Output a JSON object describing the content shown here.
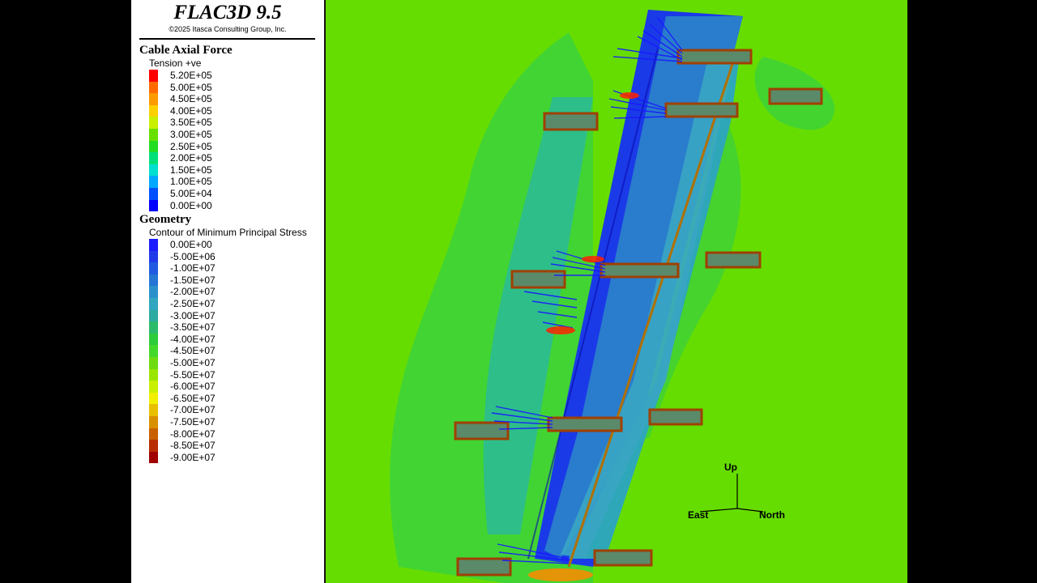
{
  "app": {
    "title": "FLAC3D 9.5",
    "copyright": "©2025 Itasca Consulting Group, Inc."
  },
  "legend_cable": {
    "title": "Cable Axial Force",
    "subtitle": "Tension +ve",
    "entries": [
      {
        "label": "5.20E+05",
        "color": "#ff0000"
      },
      {
        "label": "5.00E+05",
        "color": "#ff6a00"
      },
      {
        "label": "4.50E+05",
        "color": "#ff9a00"
      },
      {
        "label": "4.00E+05",
        "color": "#ffd000"
      },
      {
        "label": "3.50E+05",
        "color": "#c8f000"
      },
      {
        "label": "3.00E+05",
        "color": "#66e000"
      },
      {
        "label": "2.50E+05",
        "color": "#22dd22"
      },
      {
        "label": "2.00E+05",
        "color": "#00e07a"
      },
      {
        "label": "1.50E+05",
        "color": "#00e0d0"
      },
      {
        "label": "1.00E+05",
        "color": "#00a8ff"
      },
      {
        "label": "5.00E+04",
        "color": "#0050ff"
      },
      {
        "label": "0.00E+00",
        "color": "#0000ff"
      }
    ]
  },
  "legend_geometry": {
    "title": "Geometry",
    "subtitle": "Contour of Minimum Principal Stress",
    "entries": [
      {
        "label": "0.00E+00",
        "color": "#1a1aff"
      },
      {
        "label": "-5.00E+06",
        "color": "#1f3ae8"
      },
      {
        "label": "-1.00E+07",
        "color": "#1f5ae0"
      },
      {
        "label": "-1.50E+07",
        "color": "#2376d4"
      },
      {
        "label": "-2.00E+07",
        "color": "#2a90cc"
      },
      {
        "label": "-2.50E+07",
        "color": "#30a6c0"
      },
      {
        "label": "-3.00E+07",
        "color": "#2eaaa0"
      },
      {
        "label": "-3.50E+07",
        "color": "#2cbb6a"
      },
      {
        "label": "-4.00E+07",
        "color": "#2ccc3a"
      },
      {
        "label": "-4.50E+07",
        "color": "#44d82a"
      },
      {
        "label": "-5.00E+07",
        "color": "#6edc10"
      },
      {
        "label": "-5.50E+07",
        "color": "#9ae600"
      },
      {
        "label": "-6.00E+07",
        "color": "#c8f000"
      },
      {
        "label": "-6.50E+07",
        "color": "#f2f000"
      },
      {
        "label": "-7.00E+07",
        "color": "#e8c000"
      },
      {
        "label": "-7.50E+07",
        "color": "#d89000"
      },
      {
        "label": "-8.00E+07",
        "color": "#c86000"
      },
      {
        "label": "-8.50E+07",
        "color": "#b82e00"
      },
      {
        "label": "-9.00E+07",
        "color": "#a00000"
      }
    ]
  },
  "axes": {
    "up": "Up",
    "east": "East",
    "north": "North"
  }
}
